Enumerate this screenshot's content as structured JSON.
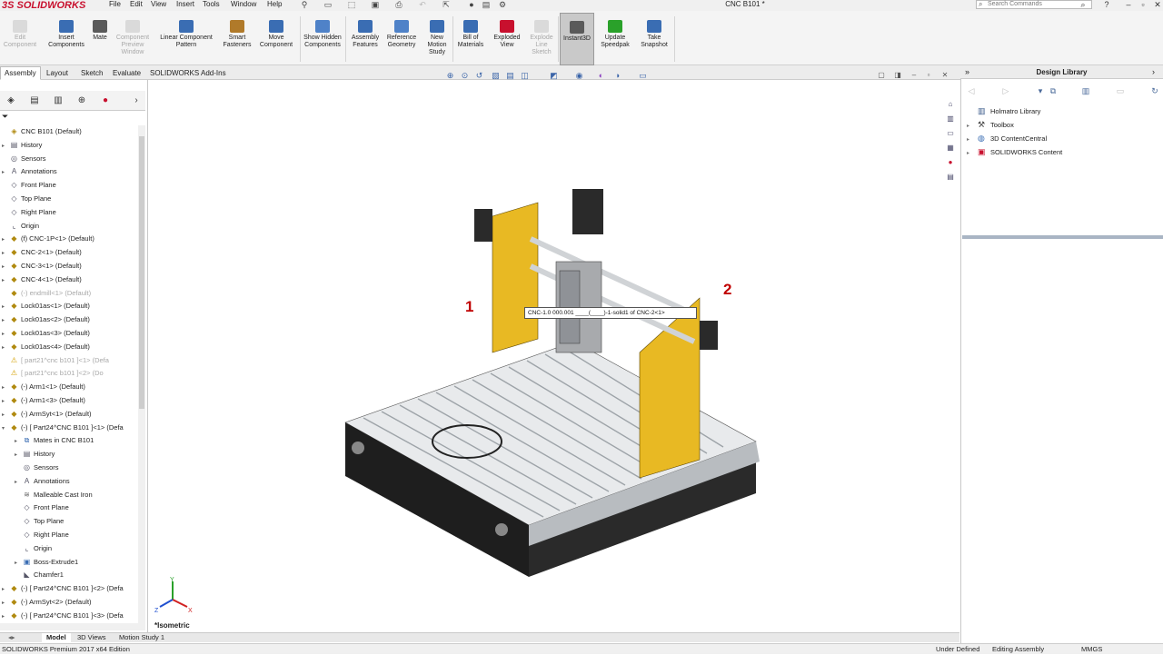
{
  "app": {
    "logo": "3S SOLIDWORKS",
    "doc_title": "CNC B101 *"
  },
  "menu": [
    "File",
    "Edit",
    "View",
    "Insert",
    "Tools",
    "Window",
    "Help"
  ],
  "search": {
    "placeholder": "Search Commands"
  },
  "ribbon": {
    "buttons": [
      {
        "label": "Edit Component",
        "disabled": true
      },
      {
        "label": "Insert Components"
      },
      {
        "label": "Mate"
      },
      {
        "label": "Component Preview Window",
        "disabled": true
      },
      {
        "label": "Linear Component Pattern"
      },
      {
        "label": "Smart Fasteners"
      },
      {
        "label": "Move Component"
      },
      {
        "label": "Show Hidden Components"
      },
      {
        "label": "Assembly Features"
      },
      {
        "label": "Reference Geometry"
      },
      {
        "label": "New Motion Study"
      },
      {
        "label": "Bill of Materials"
      },
      {
        "label": "Exploded View"
      },
      {
        "label": "Explode Line Sketch",
        "disabled": true
      },
      {
        "label": "Instant3D",
        "active": true
      },
      {
        "label": "Update Speedpak"
      },
      {
        "label": "Take Snapshot"
      }
    ]
  },
  "tabs": [
    "Assembly",
    "Layout",
    "Sketch",
    "Evaluate",
    "SOLIDWORKS Add-Ins"
  ],
  "tree": [
    {
      "label": "CNC B101  (Default)",
      "level": 0,
      "icon": "assembly-icon",
      "toggle": ""
    },
    {
      "label": "History",
      "level": 1,
      "icon": "history-icon",
      "toggle": "▸"
    },
    {
      "label": "Sensors",
      "level": 1,
      "icon": "sensor-icon",
      "toggle": ""
    },
    {
      "label": "Annotations",
      "level": 1,
      "icon": "annotation-icon",
      "toggle": "▸"
    },
    {
      "label": "Front Plane",
      "level": 1,
      "icon": "plane-icon",
      "toggle": ""
    },
    {
      "label": "Top Plane",
      "level": 1,
      "icon": "plane-icon",
      "toggle": ""
    },
    {
      "label": "Right Plane",
      "level": 1,
      "icon": "plane-icon",
      "toggle": ""
    },
    {
      "label": "Origin",
      "level": 1,
      "icon": "origin-icon",
      "toggle": ""
    },
    {
      "label": "(f) CNC-1P<1> (Default)",
      "level": 1,
      "icon": "part-icon",
      "toggle": "▸"
    },
    {
      "label": "CNC-2<1> (Default)",
      "level": 1,
      "icon": "part-icon",
      "toggle": "▸"
    },
    {
      "label": "CNC-3<1> (Default)",
      "level": 1,
      "icon": "part-icon",
      "toggle": "▸"
    },
    {
      "label": "CNC-4<1> (Default)",
      "level": 1,
      "icon": "part-icon",
      "toggle": "▸"
    },
    {
      "label": "(-) endmill<1> (Default)",
      "level": 1,
      "icon": "part-icon",
      "toggle": "",
      "dim": true
    },
    {
      "label": "Lock01as<1> (Default)",
      "level": 1,
      "icon": "part-icon",
      "toggle": "▸"
    },
    {
      "label": "Lock01as<2> (Default)",
      "level": 1,
      "icon": "part-icon",
      "toggle": "▸"
    },
    {
      "label": "Lock01as<3> (Default)",
      "level": 1,
      "icon": "part-icon",
      "toggle": "▸"
    },
    {
      "label": "Lock01as<4> (Default)",
      "level": 1,
      "icon": "part-icon",
      "toggle": "▸"
    },
    {
      "label": "[ part21^cnc b101 ]<1> (Defa",
      "level": 1,
      "icon": "warning-icon",
      "toggle": "",
      "dim": true
    },
    {
      "label": "[ part21^cnc b101 ]<2> (Do",
      "level": 1,
      "icon": "warning-icon",
      "toggle": "",
      "dim": true
    },
    {
      "label": "(-) Arm1<1> (Default)",
      "level": 1,
      "icon": "part-icon",
      "toggle": "▸"
    },
    {
      "label": "(-) Arm1<3> (Default)",
      "level": 1,
      "icon": "part-icon",
      "toggle": "▸"
    },
    {
      "label": "(-) ArmSyt<1> (Default)",
      "level": 1,
      "icon": "part-icon",
      "toggle": "▸"
    },
    {
      "label": "(-) [ Part24^CNC B101 ]<1> (Defa",
      "level": 1,
      "icon": "part-icon",
      "toggle": "▾"
    },
    {
      "label": "Mates in CNC B101",
      "level": 2,
      "icon": "mate-icon",
      "toggle": "▸"
    },
    {
      "label": "History",
      "level": 2,
      "icon": "history-icon",
      "toggle": "▸"
    },
    {
      "label": "Sensors",
      "level": 2,
      "icon": "sensor-icon",
      "toggle": ""
    },
    {
      "label": "Annotations",
      "level": 2,
      "icon": "annotation-icon",
      "toggle": "▸"
    },
    {
      "label": "Malleable Cast Iron",
      "level": 2,
      "icon": "material-icon",
      "toggle": ""
    },
    {
      "label": "Front Plane",
      "level": 2,
      "icon": "plane-icon",
      "toggle": ""
    },
    {
      "label": "Top Plane",
      "level": 2,
      "icon": "plane-icon",
      "toggle": ""
    },
    {
      "label": "Right Plane",
      "level": 2,
      "icon": "plane-icon",
      "toggle": ""
    },
    {
      "label": "Origin",
      "level": 2,
      "icon": "origin-icon",
      "toggle": ""
    },
    {
      "label": "Boss-Extrude1",
      "level": 2,
      "icon": "extrude-icon",
      "toggle": "▸"
    },
    {
      "label": "Chamfer1",
      "level": 2,
      "icon": "chamfer-icon",
      "toggle": ""
    },
    {
      "label": "(-) [ Part24^CNC B101 ]<2> (Defa",
      "level": 1,
      "icon": "part-icon",
      "toggle": "▸"
    },
    {
      "label": "(-) ArmSyt<2> (Default)",
      "level": 1,
      "icon": "part-icon",
      "toggle": "▸"
    },
    {
      "label": "(-) [ Part24^CNC B101 ]<3> (Defa",
      "level": 1,
      "icon": "part-icon",
      "toggle": "▸"
    }
  ],
  "bottom_tabs": [
    "Model",
    "3D Views",
    "Motion Study 1"
  ],
  "status": {
    "edition": "SOLIDWORKS Premium 2017 x64 Edition",
    "defined": "Under Defined",
    "mode": "Editing Assembly",
    "units": "MMGS"
  },
  "viewport": {
    "view_label": "*Isometric",
    "callout1": "1",
    "callout2": "2",
    "tooltip": "CNC-1.0 000.001 ____(____)-1-solid1 of CNC-2<1>",
    "triad": {
      "x": "X",
      "y": "Y",
      "z": "Z"
    }
  },
  "design_library": {
    "title": "Design Library",
    "items": [
      {
        "label": "Holmatro Library",
        "icon": "library-icon"
      },
      {
        "label": "Toolbox",
        "icon": "toolbox-icon"
      },
      {
        "label": "3D ContentCentral",
        "icon": "globe-icon"
      },
      {
        "label": "SOLIDWORKS Content",
        "icon": "solidworks-content-icon"
      }
    ]
  },
  "colors": {
    "yellow": "#e8b923",
    "brand_red": "#c8102e",
    "callout_red": "#c00000",
    "dark": "#222222",
    "rail": "#d0d3d6"
  }
}
